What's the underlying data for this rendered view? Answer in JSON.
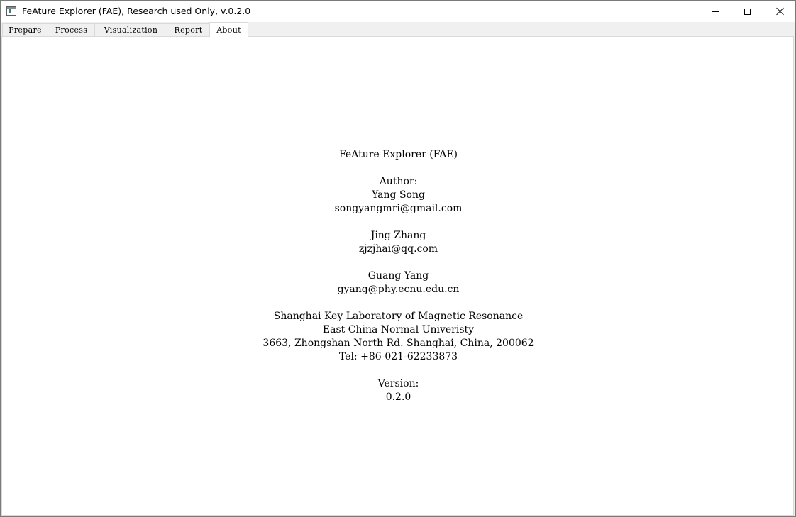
{
  "window": {
    "title": "FeAture Explorer (FAE), Research used Only, v.0.2.0"
  },
  "tabs": [
    {
      "label": "Prepare",
      "active": false
    },
    {
      "label": "Process",
      "active": false
    },
    {
      "label": "Visualization",
      "active": false
    },
    {
      "label": "Report",
      "active": false
    },
    {
      "label": "About",
      "active": true
    }
  ],
  "about": {
    "app_name": "FeAture Explorer (FAE)",
    "author_heading": "Author:",
    "authors": [
      {
        "name": "Yang Song",
        "email": "songyangmri@gmail.com"
      },
      {
        "name": "Jing Zhang",
        "email": "zjzjhai@qq.com"
      },
      {
        "name": "Guang Yang",
        "email": "gyang@phy.ecnu.edu.cn"
      }
    ],
    "lab": "Shanghai Key Laboratory of Magnetic Resonance",
    "university": "East China Normal Univeristy",
    "address": "3663, Zhongshan North Rd. Shanghai, China, 200062",
    "tel": "Tel: +86-021-62233873",
    "version_heading": "Version:",
    "version": "0.2.0"
  }
}
